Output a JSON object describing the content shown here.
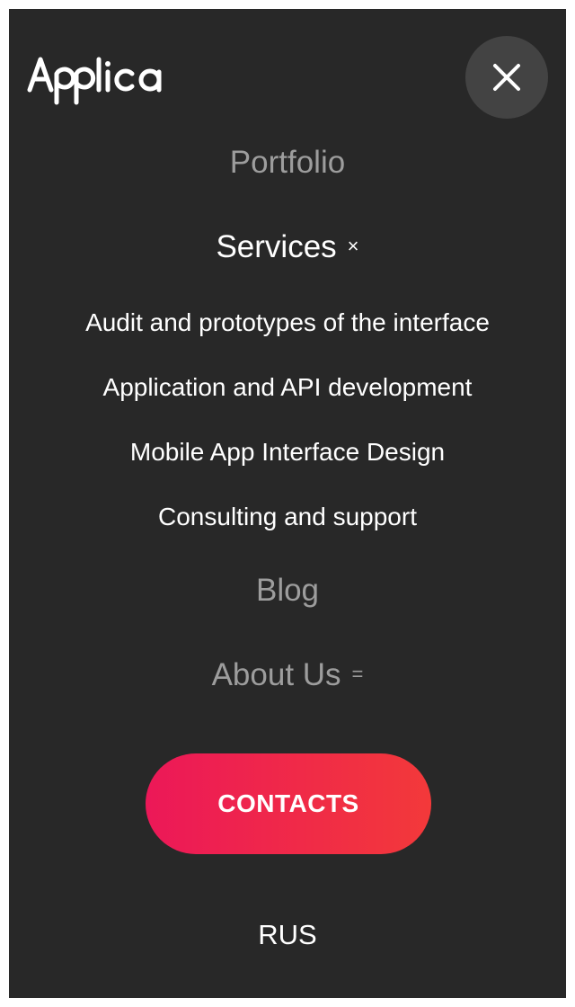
{
  "header": {
    "logo_text": "Applica",
    "close_icon": "close-icon"
  },
  "nav": {
    "portfolio": "Portfolio",
    "services": "Services",
    "services_marker": "×",
    "services_sub": [
      "Audit and prototypes of the interface",
      "Application and API development",
      "Mobile App Interface Design",
      "Consulting and support"
    ],
    "blog": "Blog",
    "about": "About Us",
    "about_marker": "="
  },
  "contacts_label": "CONTACTS",
  "language_label": "RUS",
  "colors": {
    "background": "#282828",
    "inactive_text": "#9d9d9d",
    "close_button_bg": "#434343",
    "accent_start": "#ec1858",
    "accent_end": "#f3393a"
  }
}
